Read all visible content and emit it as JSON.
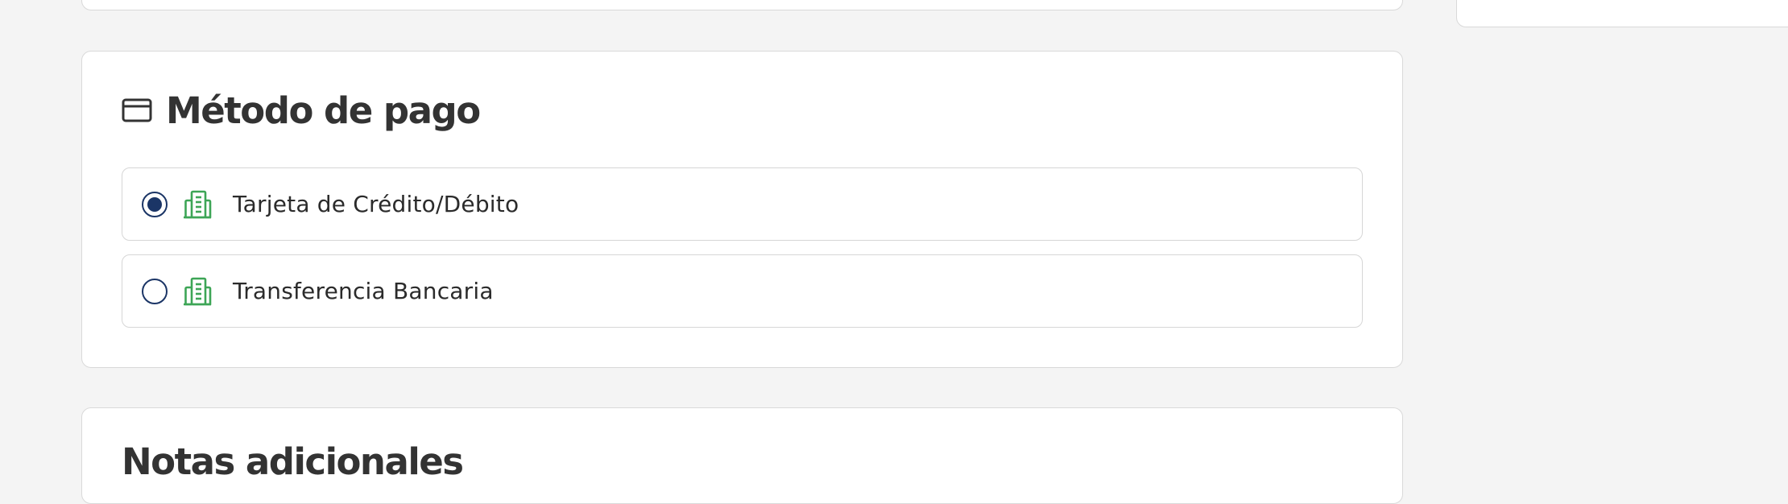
{
  "payment": {
    "title": "Método de pago",
    "options": [
      {
        "label": "Tarjeta de Crédito/Débito",
        "selected": true,
        "icon": "bank-building-icon"
      },
      {
        "label": "Transferencia Bancaria",
        "selected": false,
        "icon": "bank-building-icon"
      }
    ]
  },
  "notes": {
    "title": "Notas adicionales"
  },
  "colors": {
    "accent": "#1b3566",
    "icon_green": "#3da556",
    "background": "#f4f4f4",
    "card": "#ffffff"
  }
}
